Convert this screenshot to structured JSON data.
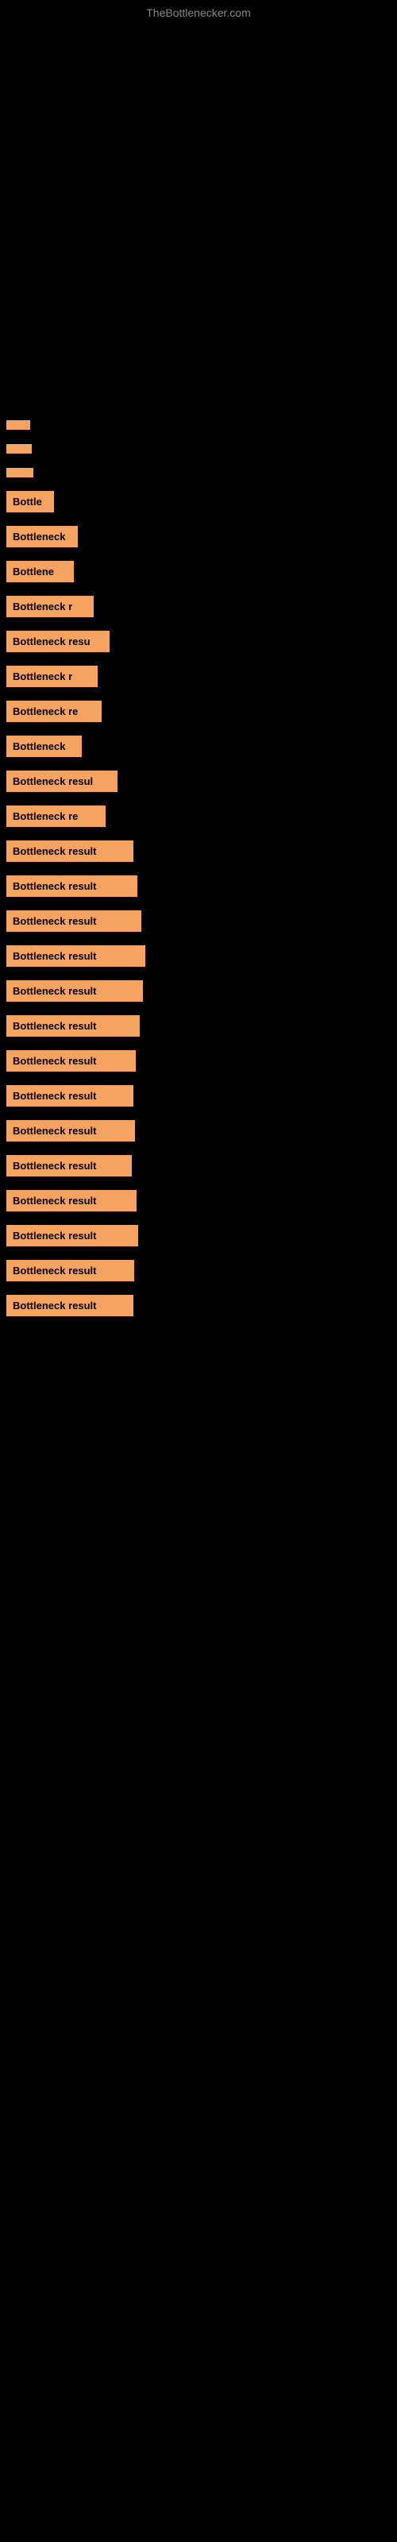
{
  "site": {
    "title": "TheBottlenecker.com"
  },
  "results": [
    {
      "id": 1,
      "label": "",
      "bar_class": "bar-w1",
      "text": ""
    },
    {
      "id": 2,
      "label": "",
      "bar_class": "bar-w2",
      "text": ""
    },
    {
      "id": 3,
      "label": "",
      "bar_class": "bar-w3",
      "text": ""
    },
    {
      "id": 4,
      "label": "Bottle",
      "bar_class": "bar-w4",
      "text": "Bottle"
    },
    {
      "id": 5,
      "label": "Bottleneck",
      "bar_class": "bar-w5",
      "text": "Bottleneck"
    },
    {
      "id": 6,
      "label": "Bottlene",
      "bar_class": "bar-w6",
      "text": "Bottlene"
    },
    {
      "id": 7,
      "label": "Bottleneck r",
      "bar_class": "bar-w7",
      "text": "Bottleneck r"
    },
    {
      "id": 8,
      "label": "Bottleneck resu",
      "bar_class": "bar-w8",
      "text": "Bottleneck resu"
    },
    {
      "id": 9,
      "label": "Bottleneck r",
      "bar_class": "bar-w9",
      "text": "Bottleneck r"
    },
    {
      "id": 10,
      "label": "Bottleneck re",
      "bar_class": "bar-w10",
      "text": "Bottleneck re"
    },
    {
      "id": 11,
      "label": "Bottleneck",
      "bar_class": "bar-w11",
      "text": "Bottleneck"
    },
    {
      "id": 12,
      "label": "Bottleneck resul",
      "bar_class": "bar-w12",
      "text": "Bottleneck resul"
    },
    {
      "id": 13,
      "label": "Bottleneck re",
      "bar_class": "bar-w13",
      "text": "Bottleneck re"
    },
    {
      "id": 14,
      "label": "Bottleneck result",
      "bar_class": "bar-w14",
      "text": "Bottleneck result"
    },
    {
      "id": 15,
      "label": "Bottleneck result",
      "bar_class": "bar-w15",
      "text": "Bottleneck result"
    },
    {
      "id": 16,
      "label": "Bottleneck result",
      "bar_class": "bar-w16",
      "text": "Bottleneck result"
    },
    {
      "id": 17,
      "label": "Bottleneck result",
      "bar_class": "bar-w17",
      "text": "Bottleneck result"
    },
    {
      "id": 18,
      "label": "Bottleneck result",
      "bar_class": "bar-w18",
      "text": "Bottleneck result"
    },
    {
      "id": 19,
      "label": "Bottleneck result",
      "bar_class": "bar-w19",
      "text": "Bottleneck result"
    },
    {
      "id": 20,
      "label": "Bottleneck result",
      "bar_class": "bar-w20",
      "text": "Bottleneck result"
    },
    {
      "id": 21,
      "label": "Bottleneck result",
      "bar_class": "bar-w21",
      "text": "Bottleneck result"
    },
    {
      "id": 22,
      "label": "Bottleneck result",
      "bar_class": "bar-w22",
      "text": "Bottleneck result"
    },
    {
      "id": 23,
      "label": "Bottleneck result",
      "bar_class": "bar-w23",
      "text": "Bottleneck result"
    },
    {
      "id": 24,
      "label": "Bottleneck result",
      "bar_class": "bar-w24",
      "text": "Bottleneck result"
    },
    {
      "id": 25,
      "label": "Bottleneck result",
      "bar_class": "bar-w25",
      "text": "Bottleneck result"
    },
    {
      "id": 26,
      "label": "Bottleneck result",
      "bar_class": "bar-w26",
      "text": "Bottleneck result"
    },
    {
      "id": 27,
      "label": "Bottleneck result",
      "bar_class": "bar-w27",
      "text": "Bottleneck result"
    }
  ]
}
